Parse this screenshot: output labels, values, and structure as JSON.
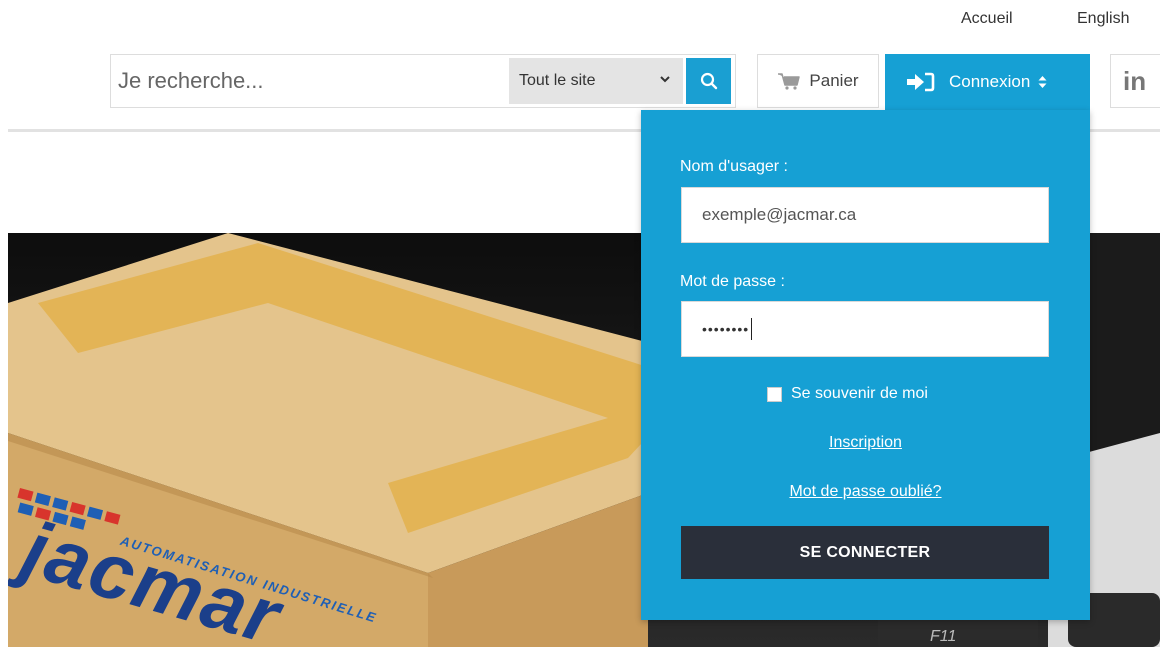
{
  "top_links": {
    "home": "Accueil",
    "language": "English"
  },
  "search": {
    "placeholder": "Je recherche...",
    "scope_selected": "Tout le site",
    "button_icon": "search-icon"
  },
  "cart": {
    "label": "Panier",
    "icon": "cart-icon"
  },
  "connexion": {
    "label": "Connexion",
    "icon": "sign-in-icon"
  },
  "social": {
    "linkedin_label": "in"
  },
  "login_form": {
    "username_label": "Nom d'usager :",
    "username_value": "exemple@jacmar.ca",
    "password_label": "Mot de passe :",
    "password_value": "••••••••",
    "remember_label": "Se souvenir de moi",
    "register_link": "Inscription",
    "forgot_link": "Mot de passe oublié?",
    "submit_label": "SE CONNECTER"
  },
  "hero": {
    "brand_tagline": "AUTOMATISATION INDUSTRIELLE",
    "brand_name": "jacmar",
    "key_label": "F11"
  },
  "colors": {
    "accent": "#16a0d4",
    "submit_bg": "#2a2f3a",
    "box_cardboard": "#d9b679",
    "box_tape": "#e0b44a",
    "brand_blue": "#1e5fb5",
    "brand_red": "#d8342c"
  }
}
